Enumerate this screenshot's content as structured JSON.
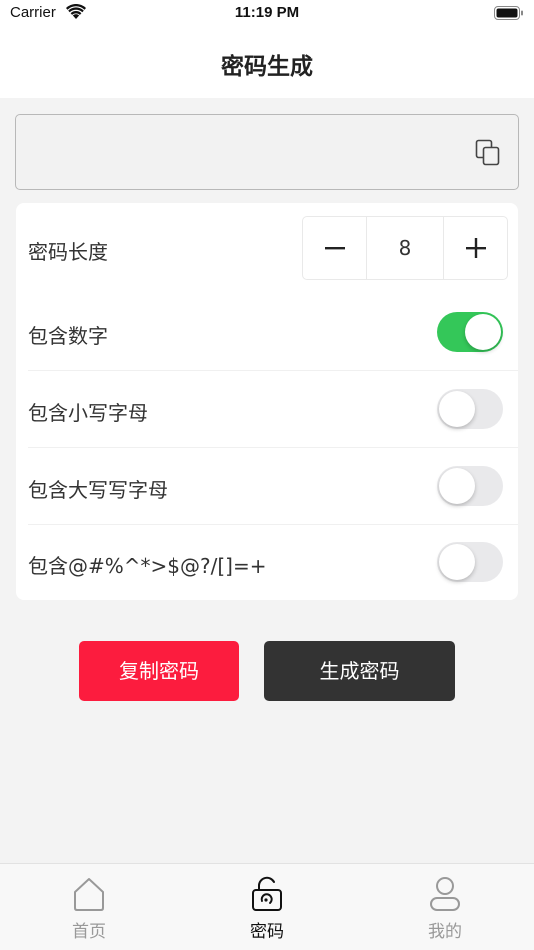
{
  "status_bar": {
    "carrier": "Carrier",
    "time": "11:19 PM"
  },
  "nav": {
    "title": "密码生成"
  },
  "password": {
    "value": ""
  },
  "settings": {
    "length_label": "密码长度",
    "length_value": "8",
    "toggles": [
      {
        "label": "包含数字",
        "on": true
      },
      {
        "label": "包含小写字母",
        "on": false
      },
      {
        "label": "包含大写写字母",
        "on": false
      },
      {
        "label": "包含@#%^*>$@?/[]=+",
        "on": false
      }
    ]
  },
  "actions": {
    "copy_label": "复制密码",
    "generate_label": "生成密码"
  },
  "tabs": [
    {
      "label": "首页",
      "icon": "home-icon",
      "active": false
    },
    {
      "label": "密码",
      "icon": "unlock-icon",
      "active": true
    },
    {
      "label": "我的",
      "icon": "user-icon",
      "active": false
    }
  ],
  "colors": {
    "toggle_on": "#34c759",
    "copy_button": "#fc1c3e",
    "generate_button": "#333333",
    "tab_inactive": "#999999"
  }
}
